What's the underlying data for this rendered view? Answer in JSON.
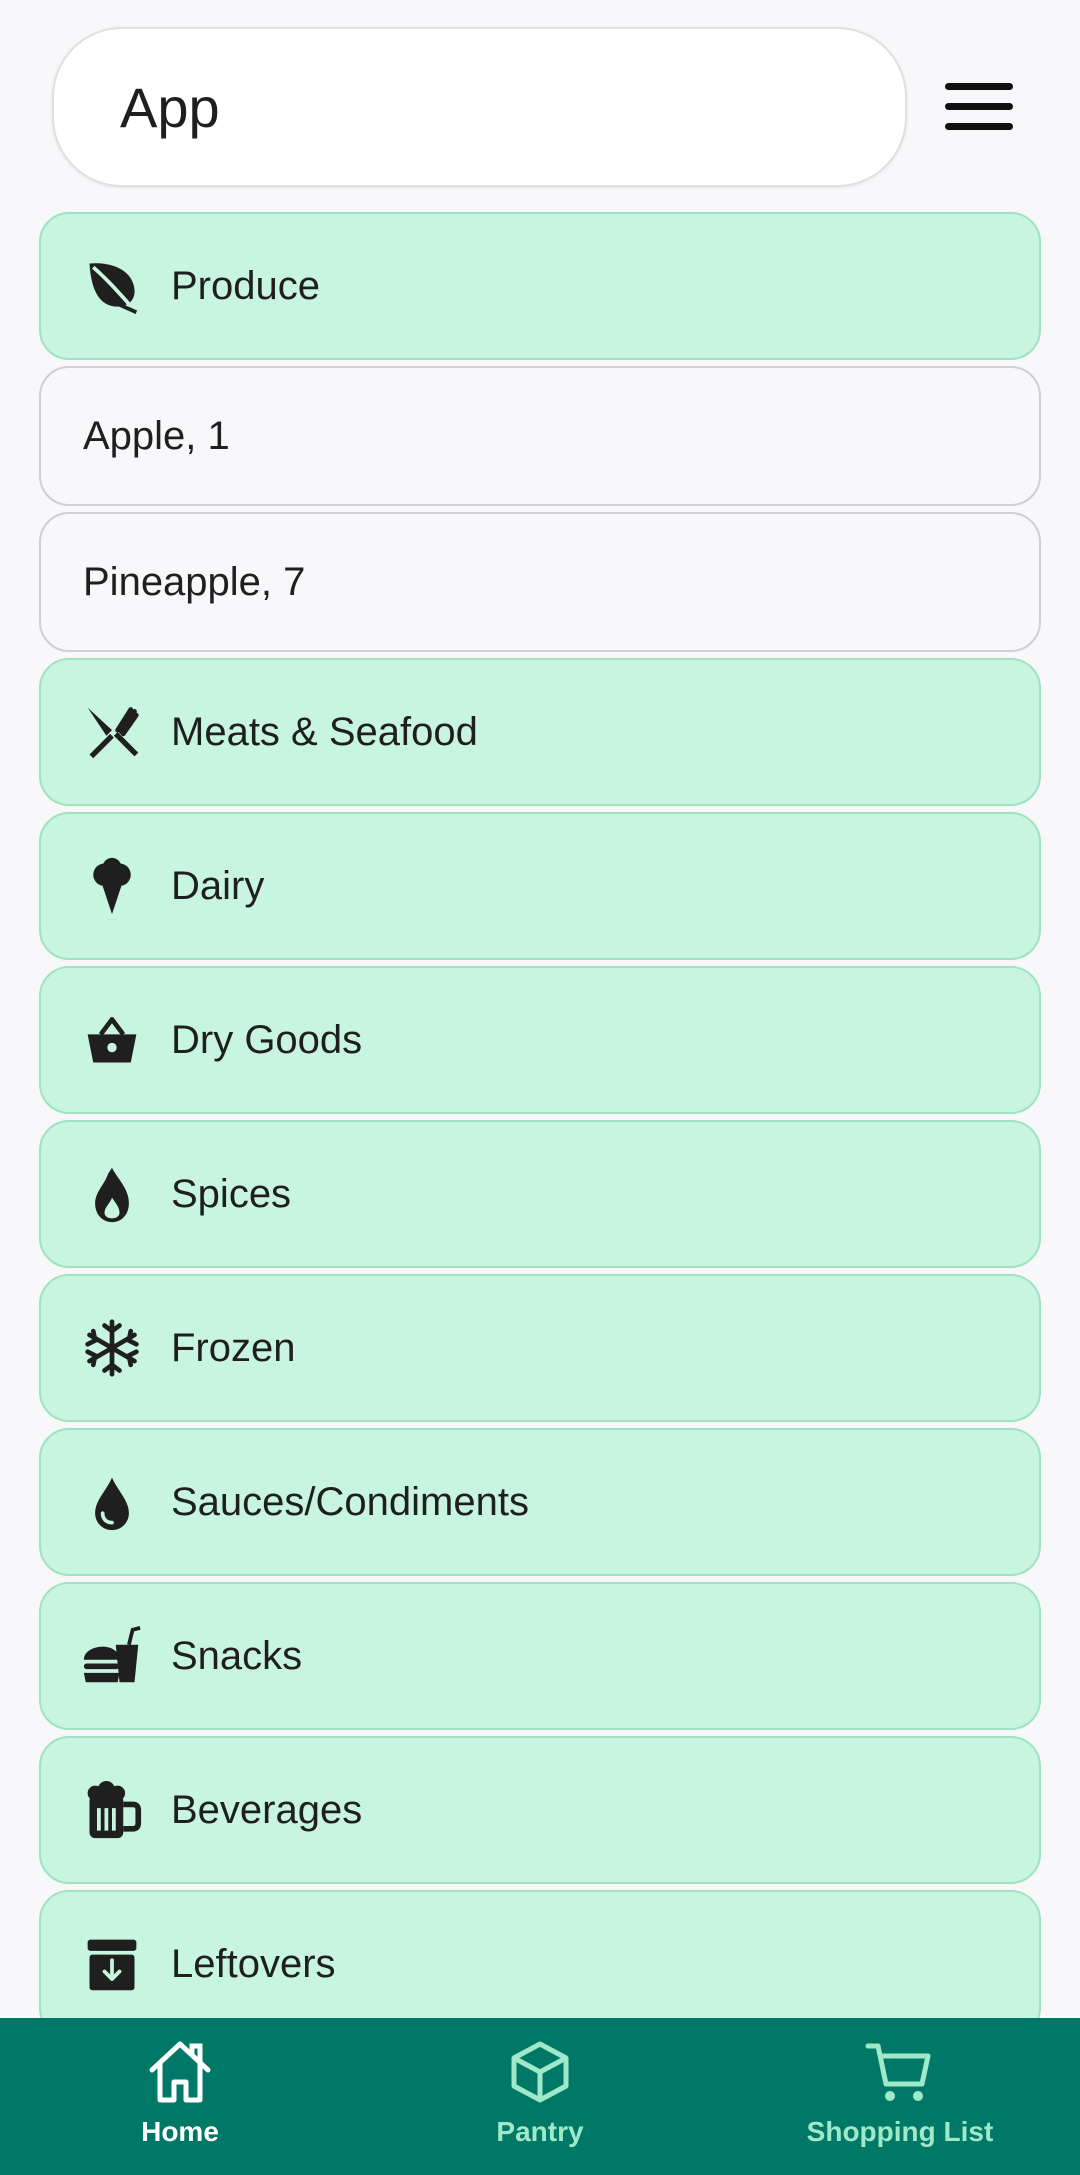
{
  "app_bar": {
    "title": "App"
  },
  "list": {
    "produce": {
      "label": "Produce",
      "icon": "leaf-icon"
    },
    "items": [
      {
        "label": "Apple, 1"
      },
      {
        "label": "Pineapple, 7"
      }
    ],
    "meats": {
      "label": "Meats & Seafood",
      "icon": "utensils-icon"
    },
    "dairy": {
      "label": "Dairy",
      "icon": "ice-cream-icon"
    },
    "dry_goods": {
      "label": "Dry Goods",
      "icon": "basket-icon"
    },
    "spices": {
      "label": "Spices",
      "icon": "fire-icon"
    },
    "frozen": {
      "label": "Frozen",
      "icon": "snowflake-icon"
    },
    "sauces": {
      "label": "Sauces/Condiments",
      "icon": "droplet-icon"
    },
    "snacks": {
      "label": "Snacks",
      "icon": "burger-soda-icon"
    },
    "beverages": {
      "label": "Beverages",
      "icon": "beer-mug-icon"
    },
    "leftovers": {
      "label": "Leftovers",
      "icon": "archive-box-icon"
    }
  },
  "bottom_nav": {
    "home": "Home",
    "pantry": "Pantry",
    "shopping_list": "Shopping List"
  },
  "colors": {
    "category_bg": "#c8f5df",
    "category_border": "#9fe3c0",
    "nav_bg": "#007868",
    "nav_active": "#ffffff",
    "nav_inactive": "#9fe8c8"
  }
}
